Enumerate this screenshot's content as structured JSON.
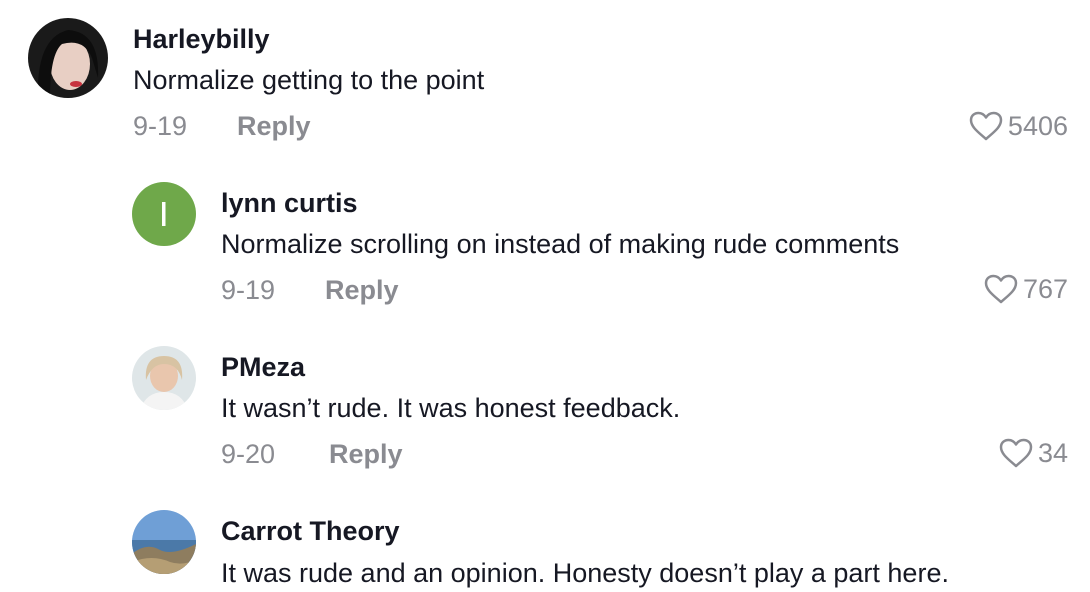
{
  "comments": [
    {
      "username": "Harleybilly",
      "text": "Normalize getting to the point",
      "date": "9-19",
      "reply_label": "Reply",
      "likes": "5406",
      "avatar_icon": "user-photo-avatar"
    },
    {
      "username": "lynn curtis",
      "text": "Normalize scrolling on instead of making rude comments",
      "date": "9-19",
      "reply_label": "Reply",
      "likes": "767",
      "avatar_initial": "l",
      "avatar_color": "#6fa84a"
    },
    {
      "username": "PMeza",
      "text": "It wasn’t rude. It was honest feedback.",
      "date": "9-20",
      "reply_label": "Reply",
      "likes": "34",
      "avatar_icon": "user-photo-avatar"
    },
    {
      "username": "Carrot Theory",
      "text": "It was rude and an opinion. Honesty doesn’t play a part here.",
      "avatar_icon": "landscape-photo-avatar"
    }
  ],
  "colors": {
    "text": "#161823",
    "muted": "#8a8b91",
    "background": "#ffffff"
  }
}
